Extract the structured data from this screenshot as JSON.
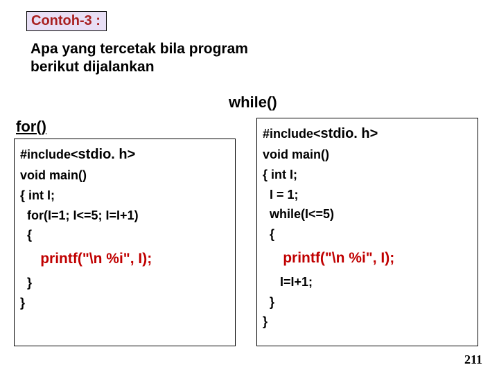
{
  "title": "Contoh-3 :",
  "question_line1": "Apa yang tercetak bila program",
  "question_line2": "berikut dijalankan",
  "while_label": "while()",
  "for_label": "for()",
  "left": {
    "l1a": "#include<",
    "l1b": "stdio. h>",
    "l2": "void main()",
    "l3": "{ int I;",
    "l4": "  for(I=1; I<=5; I=I+1)",
    "l5": "  {",
    "p1": "     ",
    "p2": "printf(",
    "p3": "\"\\n %i\"",
    "p4": ", I);",
    "l7": "  }",
    "l8": "}"
  },
  "right": {
    "l1a": "#include<",
    "l1b": "stdio. h>",
    "l2": "void main()",
    "l3": "{ int I;",
    "l4": "  I = 1;",
    "l5": "  while(I<=5)",
    "l6": "  {",
    "p1": "     ",
    "p2": "printf(",
    "p3": "\"\\n %i\"",
    "p4": ", I);",
    "l8": "     I=I+1;",
    "l9": "  }",
    "l10": "}"
  },
  "page_number": "211"
}
